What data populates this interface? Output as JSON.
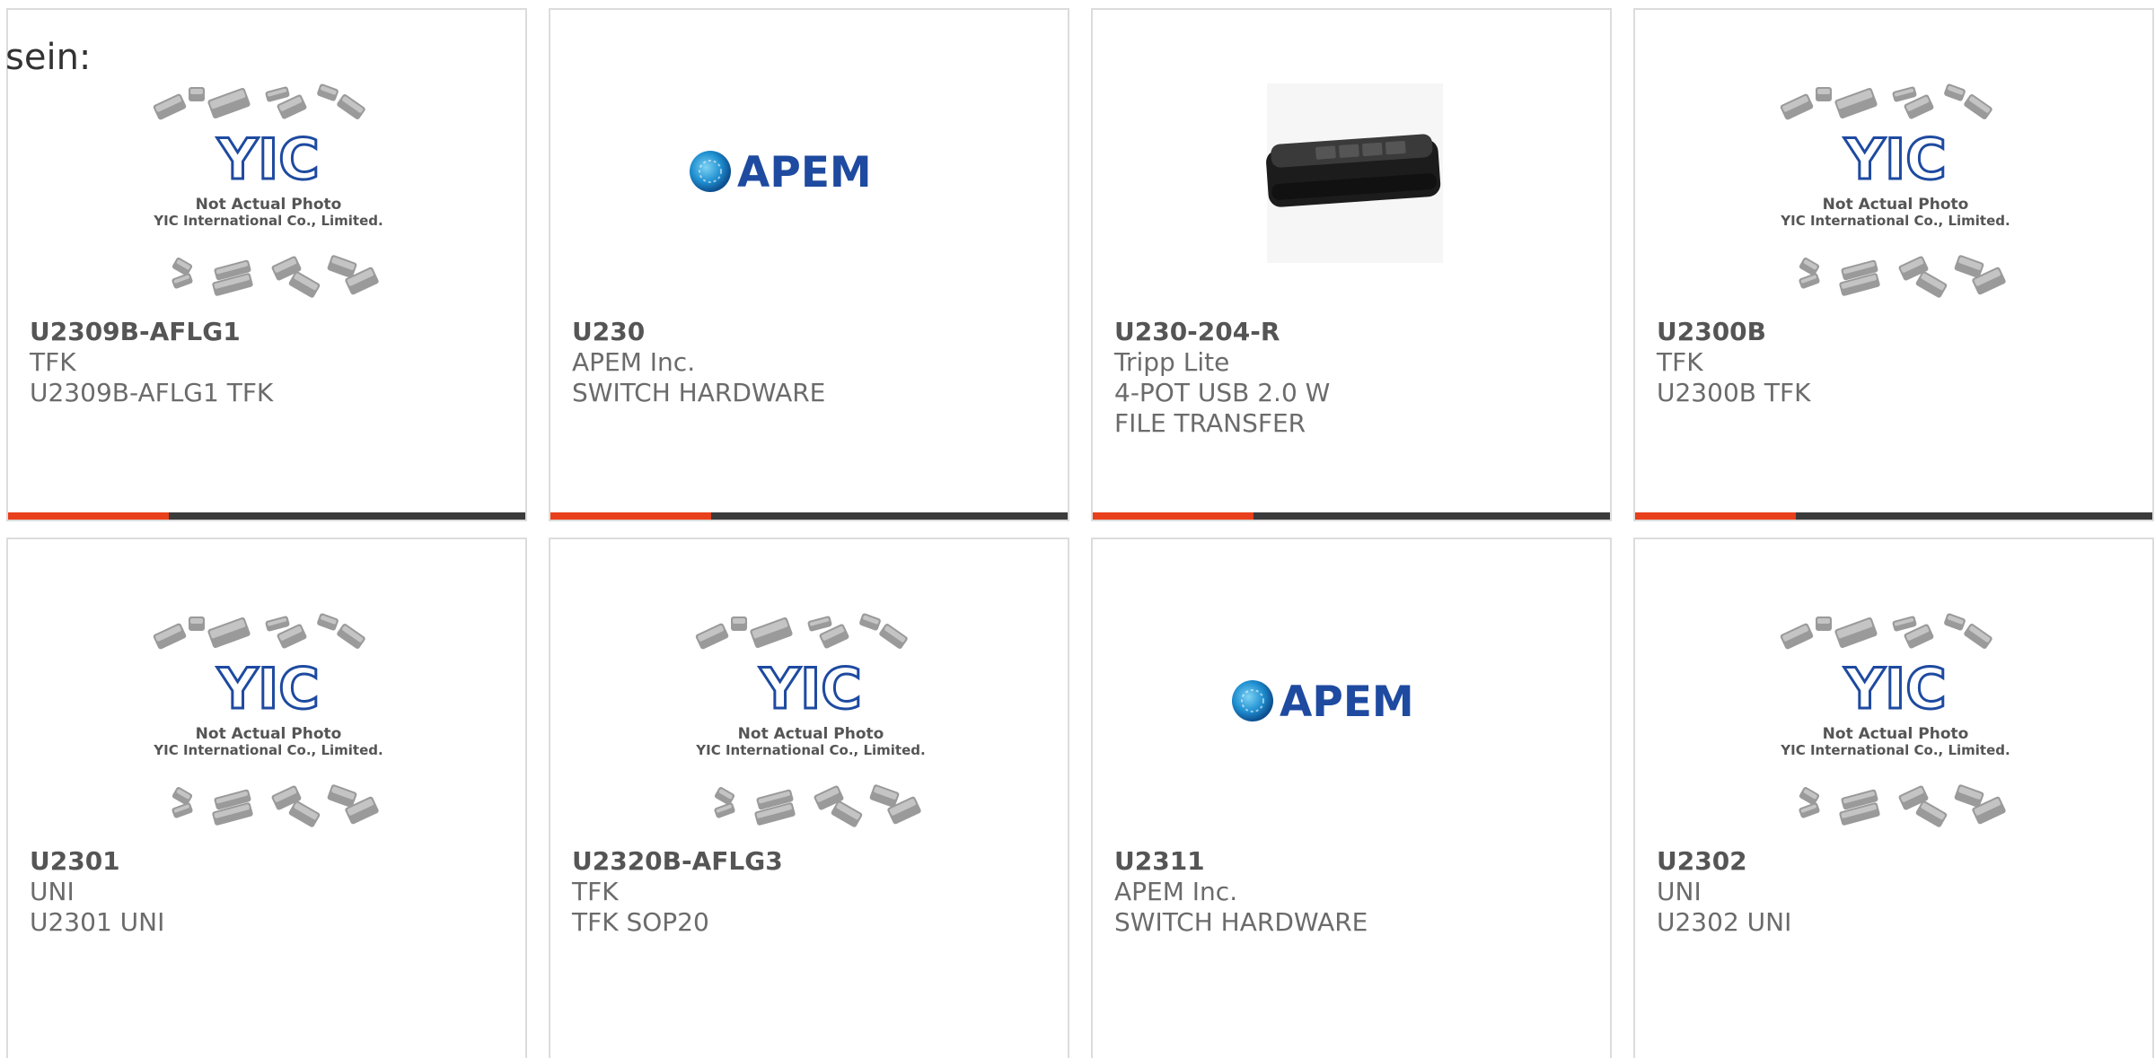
{
  "intro_text": "sein:",
  "colors": {
    "accent": "#e8401c",
    "bar_dark": "#3b3b3b",
    "logo_blue": "#1e4aa0",
    "card_border": "#dcdcdc"
  },
  "card_progress": 0.31,
  "placeholder": {
    "line1": "Not Actual Photo",
    "line2": "YIC International Co., Limited.",
    "logo_text": "YIC"
  },
  "apem_logo_text": "APEM",
  "products": [
    {
      "name": "U2309B-AFLG1",
      "manufacturer": "TFK",
      "description": "U2309B-AFLG1 TFK",
      "image": "yic-placeholder-icon"
    },
    {
      "name": "U230",
      "manufacturer": "APEM Inc.",
      "description": "SWITCH HARDWARE",
      "image": "apem-logo-icon"
    },
    {
      "name": "U230-204-R",
      "manufacturer": "Tripp Lite",
      "description": "4-POT USB 2.0 W FILE TRANSFER",
      "image": "usb-switch-device-icon"
    },
    {
      "name": "U2300B",
      "manufacturer": "TFK",
      "description": "U2300B TFK",
      "image": "yic-placeholder-icon"
    },
    {
      "name": "U2301",
      "manufacturer": "UNI",
      "description": "U2301 UNI",
      "image": "yic-placeholder-icon"
    },
    {
      "name": "U2320B-AFLG3",
      "manufacturer": "TFK",
      "description": "TFK SOP20",
      "image": "yic-placeholder-icon"
    },
    {
      "name": "U2311",
      "manufacturer": "APEM Inc.",
      "description": "SWITCH HARDWARE",
      "image": "apem-logo-icon"
    },
    {
      "name": "U2302",
      "manufacturer": "UNI",
      "description": "U2302 UNI",
      "image": "yic-placeholder-icon"
    }
  ]
}
